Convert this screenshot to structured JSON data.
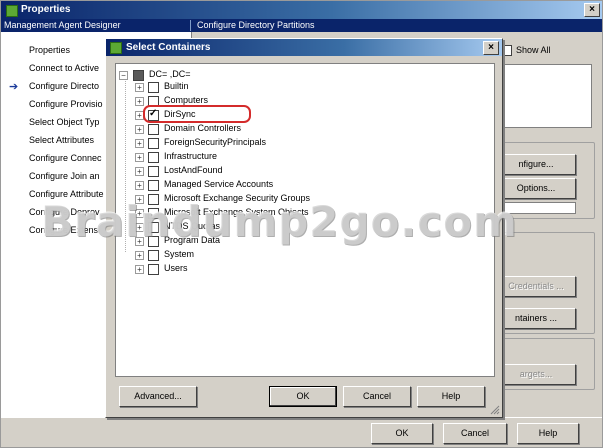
{
  "properties_window": {
    "title": "Properties",
    "tabs": [
      "Management Agent Designer",
      "Configure Directory Partitions"
    ],
    "show_all_label": "Show All",
    "close_glyph": "×",
    "nav_items": [
      {
        "label": "Properties",
        "current": false
      },
      {
        "label": "Connect to Active",
        "current": false
      },
      {
        "label": "Configure Directo",
        "current": true
      },
      {
        "label": "Configure Provisio",
        "current": false
      },
      {
        "label": "Select Object Typ",
        "current": false
      },
      {
        "label": "Select Attributes",
        "current": false
      },
      {
        "label": "Configure Connec",
        "current": false
      },
      {
        "label": "Configure Join an",
        "current": false
      },
      {
        "label": "Configure Attribute",
        "current": false
      },
      {
        "label": "Configure Deprov",
        "current": false
      },
      {
        "label": "Configure Extensi",
        "current": false
      }
    ],
    "right_buttons": {
      "configure": "nfigure...",
      "options": "Options...",
      "credentials": "Credentials ...",
      "containers": "ntainers ...",
      "targets": "argets..."
    },
    "footer_buttons": {
      "ok": "OK",
      "cancel": "Cancel",
      "help": "Help"
    }
  },
  "select_containers_dialog": {
    "title": "Select Containers",
    "close_glyph": "×",
    "root_label": "DC=          ,DC=",
    "containers": [
      {
        "label": "Builtin",
        "checked": false,
        "expandable": true
      },
      {
        "label": "Computers",
        "checked": false,
        "expandable": true
      },
      {
        "label": "DirSync",
        "checked": true,
        "expandable": true,
        "highlighted": true
      },
      {
        "label": "Domain Controllers",
        "checked": false,
        "expandable": true
      },
      {
        "label": "ForeignSecurityPrincipals",
        "checked": false,
        "expandable": true
      },
      {
        "label": "Infrastructure",
        "checked": false,
        "expandable": true
      },
      {
        "label": "LostAndFound",
        "checked": false,
        "expandable": true
      },
      {
        "label": "Managed Service Accounts",
        "checked": false,
        "expandable": true
      },
      {
        "label": "Microsoft Exchange Security Groups",
        "checked": false,
        "expandable": true
      },
      {
        "label": "Microsoft Exchange System Objects",
        "checked": false,
        "expandable": true
      },
      {
        "label": "NTDS Quotas",
        "checked": false,
        "expandable": true
      },
      {
        "label": "Program Data",
        "checked": false,
        "expandable": true
      },
      {
        "label": "System",
        "checked": false,
        "expandable": true
      },
      {
        "label": "Users",
        "checked": false,
        "expandable": true
      }
    ],
    "buttons": {
      "advanced": "Advanced...",
      "ok": "OK",
      "cancel": "Cancel",
      "help": "Help"
    }
  },
  "watermark": "Braindump2go.com",
  "colors": {
    "title_gradient_start": "#0a246a",
    "highlight_outline": "#d42b2b",
    "window_face": "#d4d0c8"
  }
}
